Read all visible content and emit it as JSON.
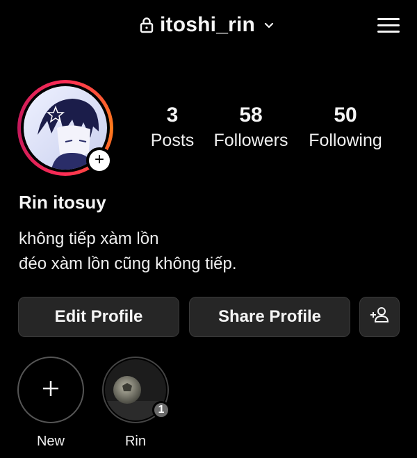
{
  "header": {
    "username": "itoshi_rin",
    "lock_icon": "lock-icon",
    "dropdown_icon": "chevron-down-icon",
    "menu_icon": "hamburger-menu-icon"
  },
  "profile": {
    "avatar_icon": "profile-avatar",
    "add_story_icon": "plus-icon",
    "display_name": "Rin itosuy",
    "bio_lines": [
      "không tiếp xàm lồn",
      "đéo xàm lồn cũng không tiếp."
    ],
    "accent_colors": [
      "#ff2d55",
      "#ff7a1a",
      "#c2185b"
    ]
  },
  "stats": {
    "posts": {
      "value": "3",
      "label": "Posts"
    },
    "followers": {
      "value": "58",
      "label": "Followers"
    },
    "following": {
      "value": "50",
      "label": "Following"
    }
  },
  "actions": {
    "edit_label": "Edit Profile",
    "share_label": "Share Profile",
    "discover_icon": "add-person-icon"
  },
  "highlights": [
    {
      "label": "New",
      "icon": "plus-icon"
    },
    {
      "label": "Rin",
      "badge": "1"
    }
  ]
}
